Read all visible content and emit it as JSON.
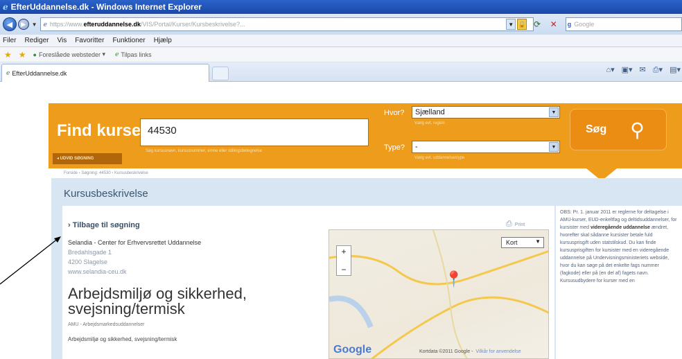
{
  "window": {
    "title": "EfterUddannelse.dk - Windows Internet Explorer"
  },
  "address_bar": {
    "protocol": "https://www.",
    "host": "efteruddannelse.dk",
    "path": "/VIS/Portal/Kurser/Kursbeskrivelse?...",
    "search_placeholder": "Google"
  },
  "menu": [
    "Filer",
    "Rediger",
    "Vis",
    "Favoritter",
    "Funktioner",
    "Hjælp"
  ],
  "favorites": {
    "suggested": "Foreslåede websteder",
    "slices": "Tilpas links"
  },
  "tab": {
    "title": "EfterUddannelse.dk"
  },
  "header": {
    "find_title": "Find kurser",
    "search_value": "44530",
    "search_hint": "Søg kursusnavn, kursusnummer, emne eller stillingsbetegnelse",
    "extended_search": "◂ UDVID SØGNING",
    "hvor_label": "Hvor?",
    "hvor_value": "Sjælland",
    "hvor_sub": "Vælg evt. region",
    "type_label": "Type?",
    "type_value": "-",
    "type_sub": "Vælg evt. uddannelsestype",
    "search_button": "Søg"
  },
  "breadcrumb": "Forside › Søgning: 44530 › Kursusbeskrivelse",
  "section_title": "Kursusbeskrivelse",
  "course": {
    "back_link": "› Tilbage til søgning",
    "print_label": "Print",
    "provider": "Selandia - Center for Erhvervsrettet Uddannelse",
    "street": "Bredahlsgade 1",
    "city": "4200 Slagelse",
    "website": "www.selandia-ceu.dk",
    "title": "Arbejdsmiljø og sikkerhed, svejsning/termisk",
    "category": "AMU - Arbejdsmarkedsuddannelser",
    "description_start": "Arbejdsmiljø og sikkerhed, svejsning/termisk"
  },
  "map": {
    "maptype": "Kort",
    "credit": "Kortdata ©2011 Google -",
    "terms_link": "Vilkår for anvendelse"
  },
  "notice": {
    "intro": "OBS: Pr. 1. januar 2011 er reglerne for deltagelse i AMU-kurser, EUD-enkeltfag og deltidsuddannelser, for kursister med ",
    "emphasis": "videregående uddannelse",
    "rest": " ændret, hvorefter skal sådanne kursister betale fuld kursusprisgift uden statstilskud. Du kan finde kursusprisgiften for kursister med en videregående uddannelse på Undervisningsministeriets webside, hvor du kan søge på det enkelte fags nummer (fagkode) eller på (en del af) fagets navn. Kursusudbydere for kurser med en"
  }
}
